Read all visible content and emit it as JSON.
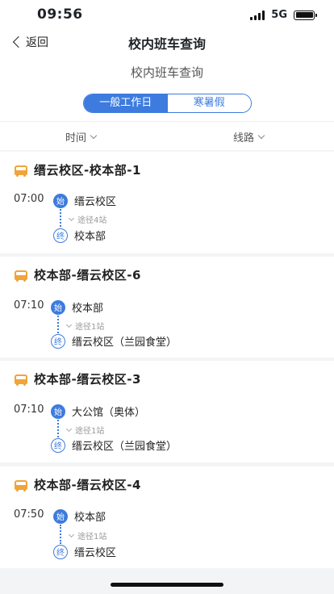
{
  "status_bar": {
    "time": "09:56",
    "network": "5G"
  },
  "nav": {
    "back_label": "返回",
    "title": "校内班车查询"
  },
  "subheader": {
    "title": "校内班车查询"
  },
  "segments": [
    {
      "label": "一般工作日",
      "active": true
    },
    {
      "label": "寒暑假",
      "active": false
    }
  ],
  "filters": {
    "time_label": "时间",
    "route_label": "线路"
  },
  "routes": [
    {
      "name": "缙云校区-校本部-1",
      "time": "07:00",
      "start": "缙云校区",
      "via": "途径4站",
      "end": "校本部"
    },
    {
      "name": "校本部-缙云校区-6",
      "time": "07:10",
      "start": "校本部",
      "via": "途径1站",
      "end": "缙云校区（兰园食堂）"
    },
    {
      "name": "校本部-缙云校区-3",
      "time": "07:10",
      "start": "大公馆（奥体）",
      "via": "途径1站",
      "end": "缙云校区（兰园食堂）"
    },
    {
      "name": "校本部-缙云校区-4",
      "time": "07:50",
      "start": "校本部",
      "via": "途径1站",
      "end": "缙云校区"
    }
  ],
  "badges": {
    "start": "始",
    "end": "终"
  }
}
